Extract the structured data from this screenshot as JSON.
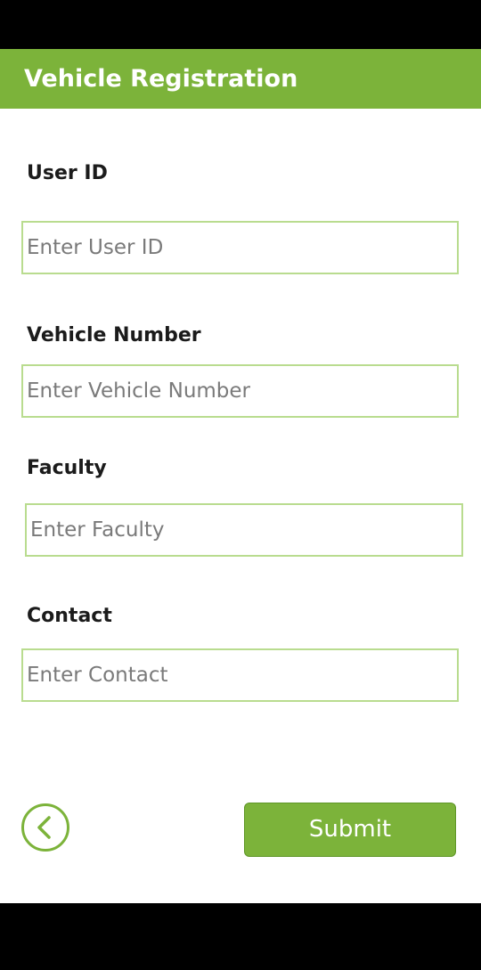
{
  "app_bar": {
    "title": "Vehicle Registration"
  },
  "form": {
    "user_id": {
      "label": "User ID",
      "placeholder": "Enter User ID",
      "value": ""
    },
    "vehicle_number": {
      "label": "Vehicle Number",
      "placeholder": "Enter Vehicle Number",
      "value": ""
    },
    "faculty": {
      "label": "Faculty",
      "placeholder": "Enter Faculty",
      "value": ""
    },
    "contact": {
      "label": "Contact",
      "placeholder": "Enter Contact",
      "value": ""
    }
  },
  "actions": {
    "back_icon": "chevron-left-circle-icon",
    "submit_label": "Submit"
  },
  "colors": {
    "accent": "#7cb33a",
    "input_border": "#b9dc8f",
    "label_text": "#1b1b1b",
    "placeholder_text": "#7a7a7a",
    "system_bars": "#000000"
  }
}
